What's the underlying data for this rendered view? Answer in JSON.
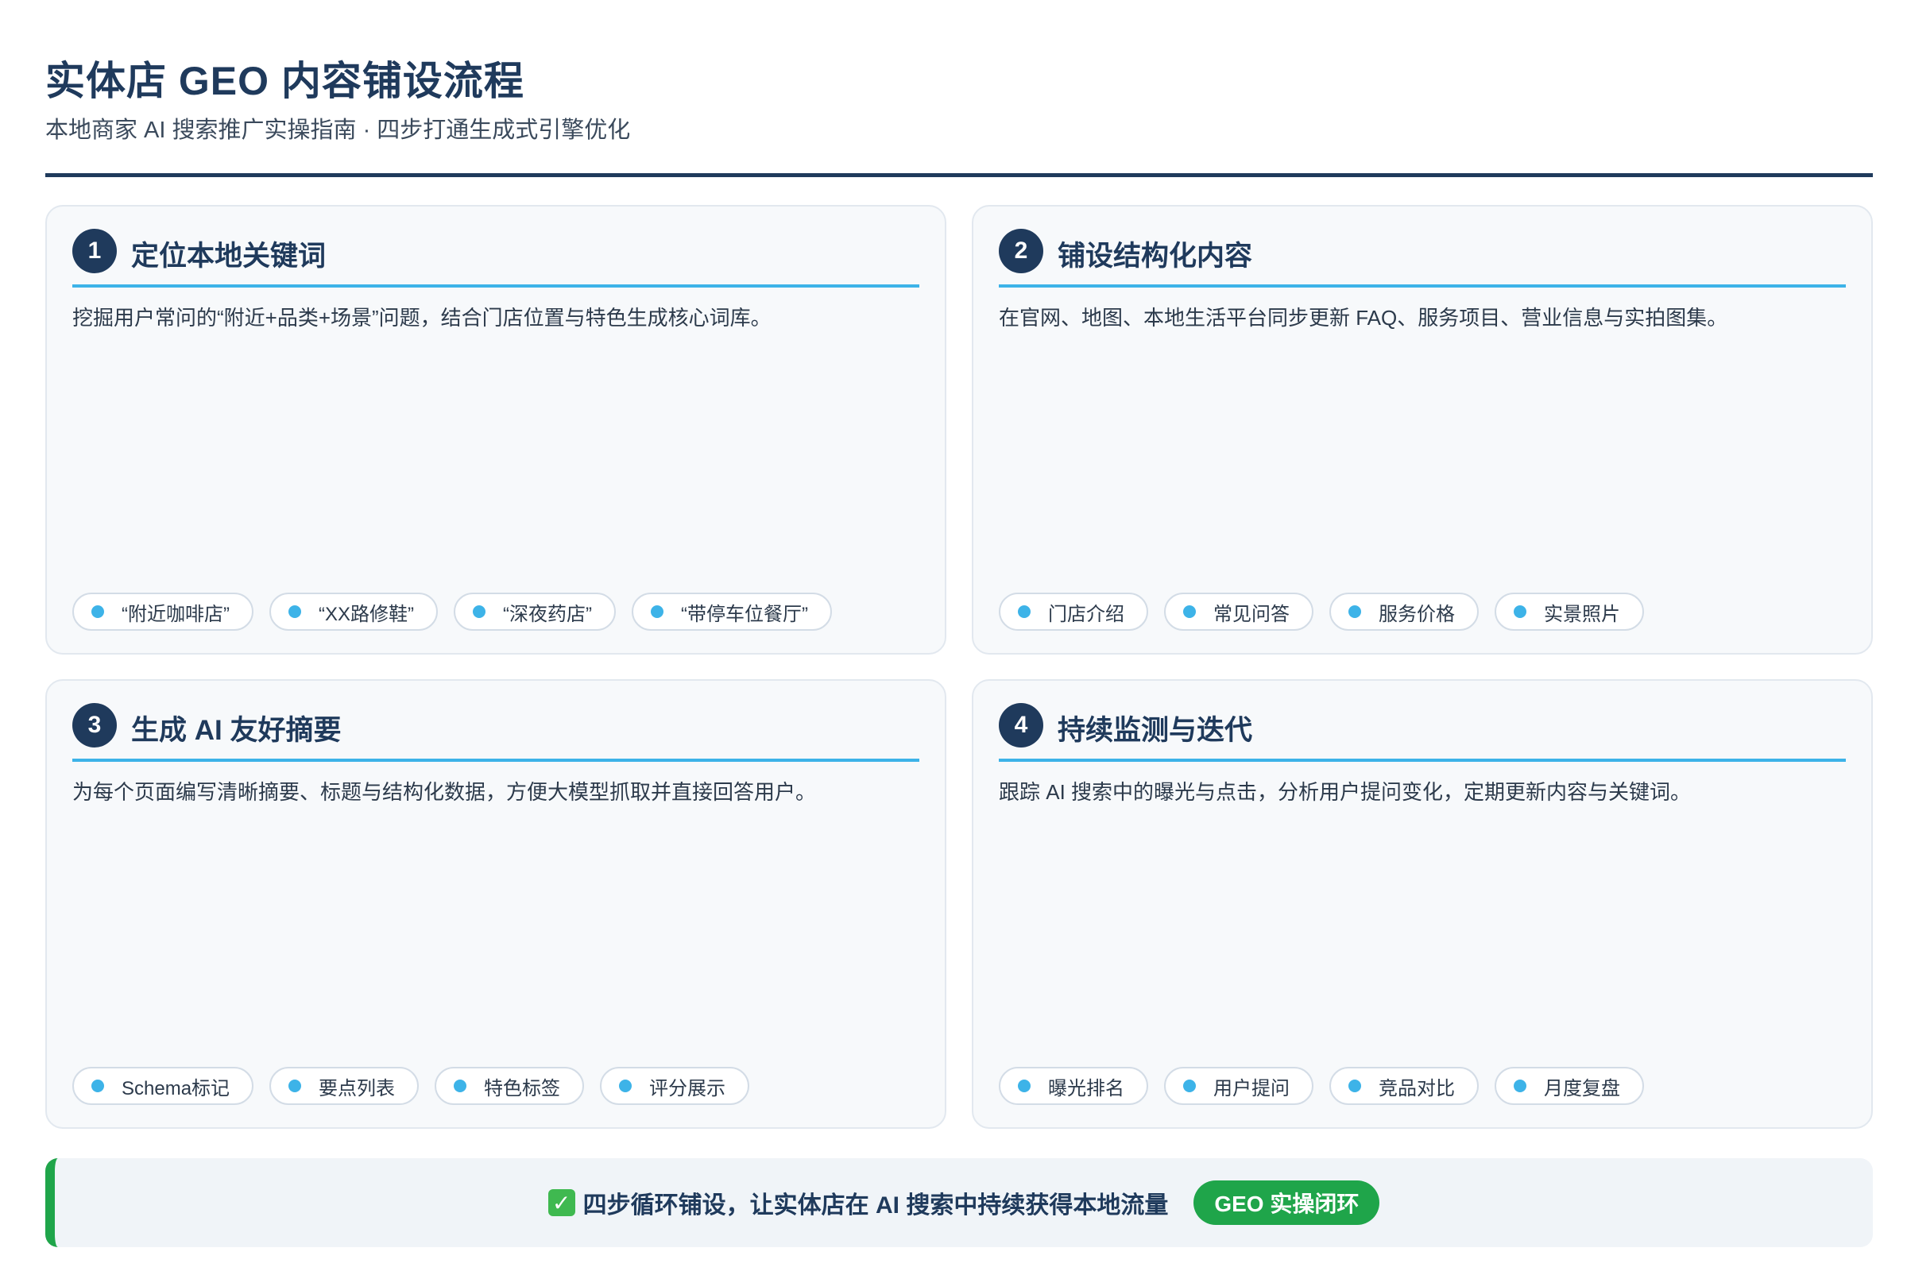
{
  "header": {
    "title": "实体店 GEO 内容铺设流程",
    "subtitle": "本地商家 AI 搜索推广实操指南 · 四步打通生成式引擎优化"
  },
  "steps": [
    {
      "number": "1",
      "title": "定位本地关键词",
      "description": "挖掘用户常问的“附近+品类+场景”问题，结合门店位置与特色生成核心词库。",
      "tags": [
        "“附近咖啡店”",
        "“XX路修鞋”",
        "“深夜药店”",
        "“带停车位餐厅”"
      ]
    },
    {
      "number": "2",
      "title": "铺设结构化内容",
      "description": "在官网、地图、本地生活平台同步更新 FAQ、服务项目、营业信息与实拍图集。",
      "tags": [
        "门店介绍",
        "常见问答",
        "服务价格",
        "实景照片"
      ]
    },
    {
      "number": "3",
      "title": "生成 AI 友好摘要",
      "description": "为每个页面编写清晰摘要、标题与结构化数据，方便大模型抓取并直接回答用户。",
      "tags": [
        "Schema标记",
        "要点列表",
        "特色标签",
        "评分展示"
      ]
    },
    {
      "number": "4",
      "title": "持续监测与迭代",
      "description": "跟踪 AI 搜索中的曝光与点击，分析用户提问变化，定期更新内容与关键词。",
      "tags": [
        "曝光排名",
        "用户提问",
        "竞品对比",
        "月度复盘"
      ]
    }
  ],
  "banner": {
    "icon": "check-mark-icon",
    "text": "四步循环铺设，让实体店在 AI 搜索中持续获得本地流量",
    "badge": "GEO 实操闭环"
  },
  "colors": {
    "navy": "#1f3a5c",
    "accent_blue": "#3db3e8",
    "accent_green": "#1fa54a",
    "card_bg": "#f7f9fb"
  }
}
